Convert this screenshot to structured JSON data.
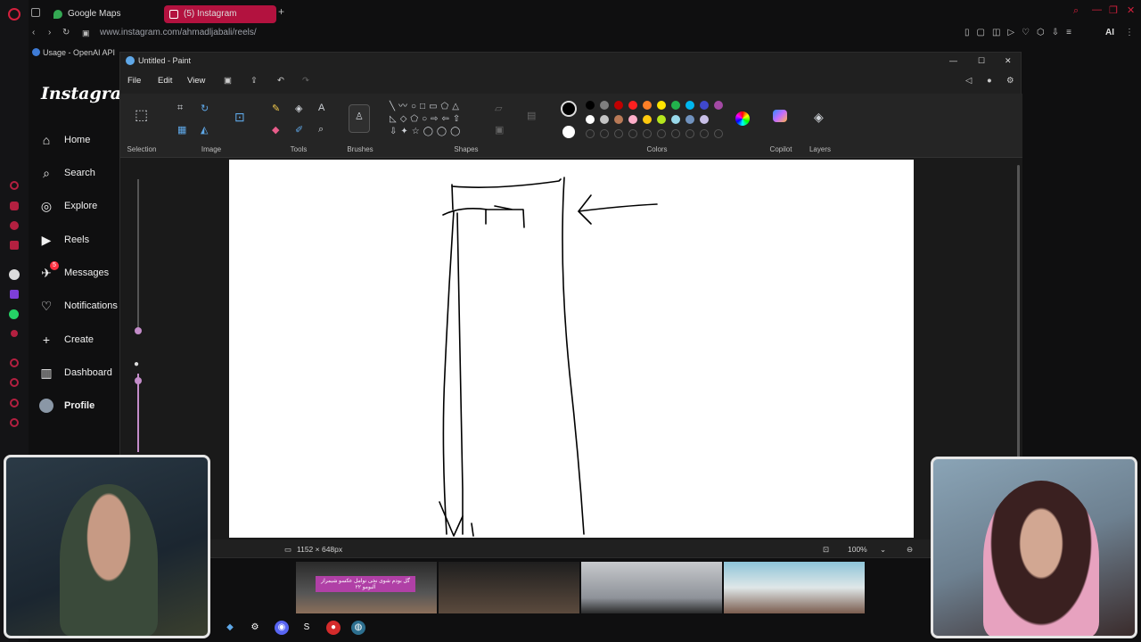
{
  "browser": {
    "tabs": [
      {
        "label": "Google Maps"
      },
      {
        "label": "(5) Instagram"
      }
    ],
    "url": "www.instagram.com/ahmadljabali/reels/",
    "bookmarks": [
      {
        "label": "Usage - OpenAI API"
      }
    ],
    "ai_label": "AI"
  },
  "instagram": {
    "logo": "Instagram",
    "nav": [
      {
        "label": "Home",
        "icon": "home-icon"
      },
      {
        "label": "Search",
        "icon": "search-icon"
      },
      {
        "label": "Explore",
        "icon": "compass-icon"
      },
      {
        "label": "Reels",
        "icon": "reels-icon"
      },
      {
        "label": "Messages",
        "icon": "messenger-icon",
        "badge": "5"
      },
      {
        "label": "Notifications",
        "icon": "heart-icon"
      },
      {
        "label": "Create",
        "icon": "plus-icon"
      },
      {
        "label": "Dashboard",
        "icon": "dashboard-icon"
      },
      {
        "label": "Profile",
        "icon": "avatar-icon"
      }
    ]
  },
  "paint": {
    "title": "Untitled - Paint",
    "menu": [
      "File",
      "Edit",
      "View"
    ],
    "groups": {
      "selection": "Selection",
      "image": "Image",
      "tools": "Tools",
      "brushes": "Brushes",
      "shapes": "Shapes",
      "colors": "Colors",
      "copilot": "Copilot",
      "layers": "Layers"
    },
    "palette_row1": [
      "#000000",
      "#7f7f7f",
      "#c00000",
      "#ff2020",
      "#ff7f27",
      "#ffe400",
      "#22b14c",
      "#00b7ef",
      "#3f48cc",
      "#a349a4"
    ],
    "palette_row2": [
      "#ffffff",
      "#c3c3c3",
      "#b97a57",
      "#ffaec9",
      "#ffc90e",
      "#b5e61d",
      "#99d9ea",
      "#7092be",
      "#c8bfe7"
    ],
    "status": {
      "canvas_size": "1152 × 648px",
      "zoom": "100%"
    }
  },
  "reel_caption": "گل بودم شوی نخی نوامل عکسو شیمراز آلبومو ۲۲"
}
